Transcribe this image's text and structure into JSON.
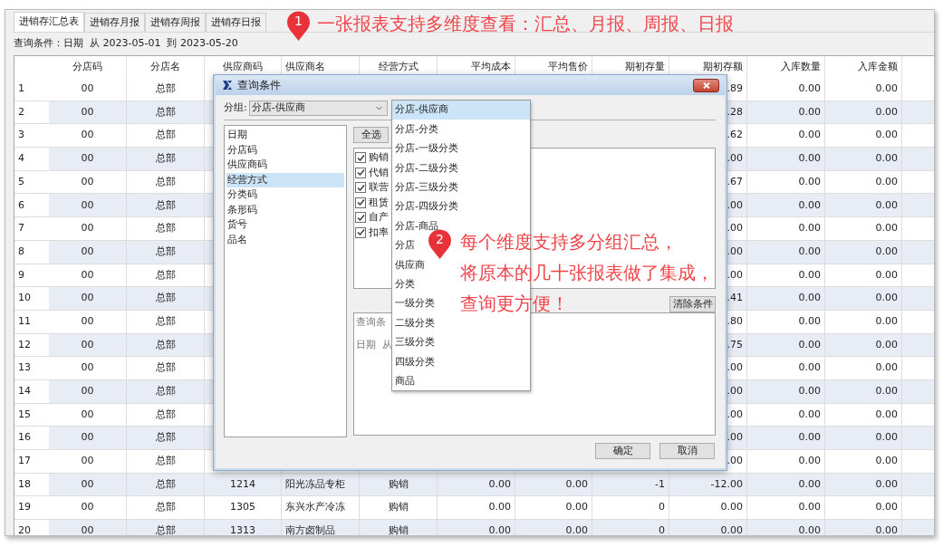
{
  "tabs": [
    {
      "label": "进销存汇总表",
      "selected": true
    },
    {
      "label": "进销存月报",
      "selected": false
    },
    {
      "label": "进销存周报",
      "selected": false
    },
    {
      "label": "进销存日报",
      "selected": false
    }
  ],
  "query_summary": "查询条件：日期  从 2023-05-01  到 2023-05-20",
  "table": {
    "columns": [
      "分店码",
      "分店名",
      "供应商码",
      "供应商名",
      "经营方式",
      "平均成本",
      "平均售价",
      "期初存量",
      "期初存额",
      "入库数量",
      "入库金额"
    ],
    "rows": [
      {
        "no": "1",
        "cells": [
          "00",
          "总部",
          ".89",
          "0.00",
          "0.00"
        ]
      },
      {
        "no": "2",
        "cells": [
          "00",
          "总部",
          ".28",
          "0.00",
          "0.00"
        ]
      },
      {
        "no": "3",
        "cells": [
          "00",
          "总部",
          ".62",
          "0.00",
          "0.00"
        ]
      },
      {
        "no": "4",
        "cells": [
          "00",
          "总部",
          ".00",
          "0.00",
          "0.00"
        ]
      },
      {
        "no": "5",
        "cells": [
          "00",
          "总部",
          ".67",
          "0.00",
          "0.00"
        ]
      },
      {
        "no": "6",
        "cells": [
          "00",
          "总部",
          ".00",
          "0.00",
          "0.00"
        ]
      },
      {
        "no": "7",
        "cells": [
          "00",
          "总部",
          ".00",
          "0.00",
          "0.00"
        ]
      },
      {
        "no": "8",
        "cells": [
          "00",
          "总部",
          ".00",
          "0.00",
          "0.00"
        ]
      },
      {
        "no": "9",
        "cells": [
          "00",
          "总部",
          ".00",
          "0.00",
          "0.00"
        ]
      },
      {
        "no": "10",
        "cells": [
          "00",
          "总部",
          ".41",
          "0.00",
          "0.00"
        ]
      },
      {
        "no": "11",
        "cells": [
          "00",
          "总部",
          ".80",
          "0.00",
          "0.00"
        ]
      },
      {
        "no": "12",
        "cells": [
          "00",
          "总部",
          ".75",
          "0.00",
          "0.00"
        ]
      },
      {
        "no": "13",
        "cells": [
          "00",
          "总部",
          ".00",
          "0.00",
          "0.00"
        ]
      },
      {
        "no": "14",
        "cells": [
          "00",
          "总部",
          ".00",
          "0.00",
          "0.00"
        ]
      },
      {
        "no": "15",
        "cells": [
          "00",
          "总部",
          ".00",
          "0.00",
          "0.00"
        ]
      },
      {
        "no": "16",
        "cells": [
          "00",
          "总部",
          ".00",
          "0.00",
          "0.00"
        ]
      },
      {
        "no": "17",
        "cells": [
          "00",
          "总部",
          ".00",
          "0.00",
          "0.00"
        ]
      },
      {
        "no": "18",
        "cells": [
          "00",
          "总部",
          "1214",
          "阳光冻品专柜",
          "购销",
          "0.00",
          "0.00",
          "-1",
          "-12.00",
          "0.00",
          "0.00"
        ]
      },
      {
        "no": "19",
        "cells": [
          "00",
          "总部",
          "1305",
          "东兴水产冷冻",
          "购销",
          "0.00",
          "0.00",
          "0",
          "0.00",
          "0.00",
          "0.00"
        ]
      },
      {
        "no": "20",
        "cells": [
          "00",
          "总部",
          "1313",
          "南方卤制品",
          "购销",
          "0.00",
          "0.00",
          "0",
          "0.00",
          "0.00",
          "0.00"
        ]
      }
    ]
  },
  "dialog": {
    "title": "查询条件",
    "group_label": "分组:",
    "group_value": "分店-供应商",
    "fields": [
      {
        "label": "日期",
        "selected": false
      },
      {
        "label": "分店码",
        "selected": false
      },
      {
        "label": "供应商码",
        "selected": false
      },
      {
        "label": "经营方式",
        "selected": true
      },
      {
        "label": "分类码",
        "selected": false
      },
      {
        "label": "条形码",
        "selected": false
      },
      {
        "label": "货号",
        "selected": false
      },
      {
        "label": "品名",
        "selected": false
      }
    ],
    "select_all": "全选",
    "options": [
      {
        "label": "购销",
        "checked": true
      },
      {
        "label": "代销",
        "checked": true
      },
      {
        "label": "联营",
        "checked": true
      },
      {
        "label": "租赁",
        "checked": true
      },
      {
        "label": "自产",
        "checked": true
      },
      {
        "label": "扣率",
        "checked": true
      }
    ],
    "clear_button": "清除条件",
    "conditions": [
      "查询条",
      "日期  从"
    ],
    "ok": "确定",
    "cancel": "取消",
    "dropdown": [
      {
        "label": "分店-供应商",
        "selected": true
      },
      {
        "label": "分店-分类",
        "selected": false
      },
      {
        "label": "分店-一级分类",
        "selected": false
      },
      {
        "label": "分店-二级分类",
        "selected": false
      },
      {
        "label": "分店-三级分类",
        "selected": false
      },
      {
        "label": "分店-四级分类",
        "selected": false
      },
      {
        "label": "分店-商品",
        "selected": false
      },
      {
        "label": "分店",
        "selected": false
      },
      {
        "label": "供应商",
        "selected": false
      },
      {
        "label": "分类",
        "selected": false
      },
      {
        "label": "一级分类",
        "selected": false
      },
      {
        "label": "二级分类",
        "selected": false
      },
      {
        "label": "三级分类",
        "selected": false
      },
      {
        "label": "四级分类",
        "selected": false
      },
      {
        "label": "商品",
        "selected": false
      }
    ]
  },
  "annotations": [
    {
      "marker": "1",
      "lines": [
        "一张报表支持多维度查看：汇总、月报、周报、日报"
      ]
    },
    {
      "marker": "2",
      "lines": [
        "每个维度支持多分组汇总，",
        "将原本的几十张报表做了集成，",
        "查询更方便！"
      ]
    }
  ]
}
